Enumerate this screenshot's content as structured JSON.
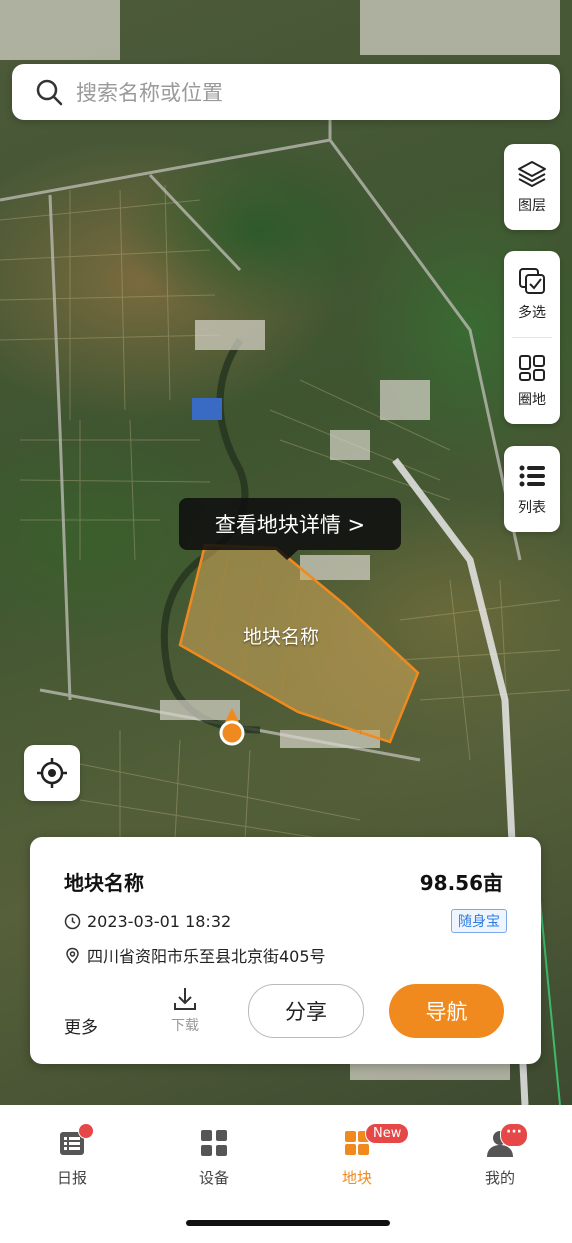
{
  "search": {
    "placeholder": "搜索名称或位置"
  },
  "tools": {
    "layers_label": "图层",
    "multiselect_label": "多选",
    "circle_label": "圈地",
    "list_label": "列表"
  },
  "map": {
    "tooltip": "查看地块详情 >",
    "field_label": "地块名称",
    "field_color": "#f08a1e"
  },
  "card": {
    "title": "地块名称",
    "area": "98.56亩",
    "datetime": "2023-03-01 18:32",
    "tag": "随身宝",
    "address": "四川省资阳市乐至县北京街405号",
    "more_label": "更多",
    "download_label": "下载",
    "share_label": "分享",
    "navigate_label": "导航"
  },
  "tabs": [
    {
      "label": "日报",
      "icon": "report-icon"
    },
    {
      "label": "设备",
      "icon": "device-icon"
    },
    {
      "label": "地块",
      "icon": "field-icon",
      "badge": "New",
      "active": true
    },
    {
      "label": "我的",
      "icon": "profile-icon",
      "badge": "···"
    }
  ],
  "colors": {
    "accent": "#f08a1e",
    "badge": "#e64848",
    "tag": "#2f7be0"
  }
}
